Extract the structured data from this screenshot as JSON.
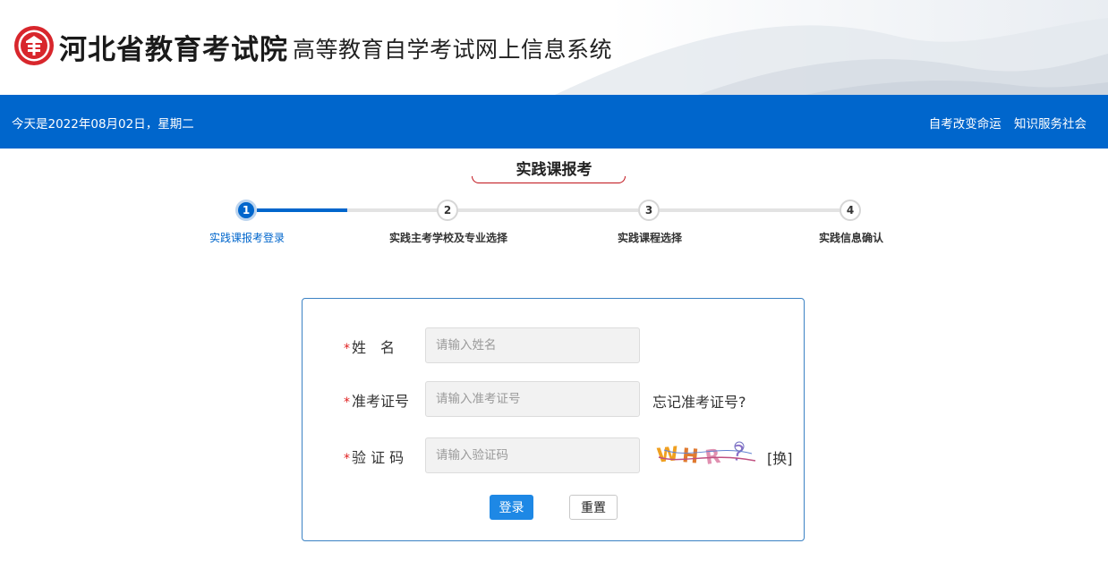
{
  "header": {
    "org_name": "河北省教育考试院",
    "system_name": "高等教育自学考试网上信息系统",
    "logo_icon": "exam-authority-seal-icon"
  },
  "topbar": {
    "date_text": "今天是2022年08月02日，星期二",
    "slogan_1": "自考改变命运",
    "slogan_2": "知识服务社会",
    "bg_color": "#0066cc"
  },
  "page": {
    "title": "实践课报考"
  },
  "steps": [
    {
      "number": "1",
      "label": "实践课报考登录",
      "active": true
    },
    {
      "number": "2",
      "label": "实践主考学校及专业选择",
      "active": false
    },
    {
      "number": "3",
      "label": "实践课程选择",
      "active": false
    },
    {
      "number": "4",
      "label": "实践信息确认",
      "active": false
    }
  ],
  "form": {
    "required_mark": "*",
    "name": {
      "label": "姓　名",
      "value": "",
      "placeholder": "请输入姓名"
    },
    "ticket": {
      "label": "准考证号",
      "value": "",
      "placeholder": "请输入准考证号",
      "forgot_link": "忘记准考证号?"
    },
    "captcha": {
      "label": "验 证 码",
      "value": "",
      "placeholder": "请输入验证码",
      "refresh_label": "[换]",
      "image_text": "WHR?"
    },
    "login_button": "登录",
    "reset_button": "重置",
    "accent_color": "#1e88e5"
  }
}
